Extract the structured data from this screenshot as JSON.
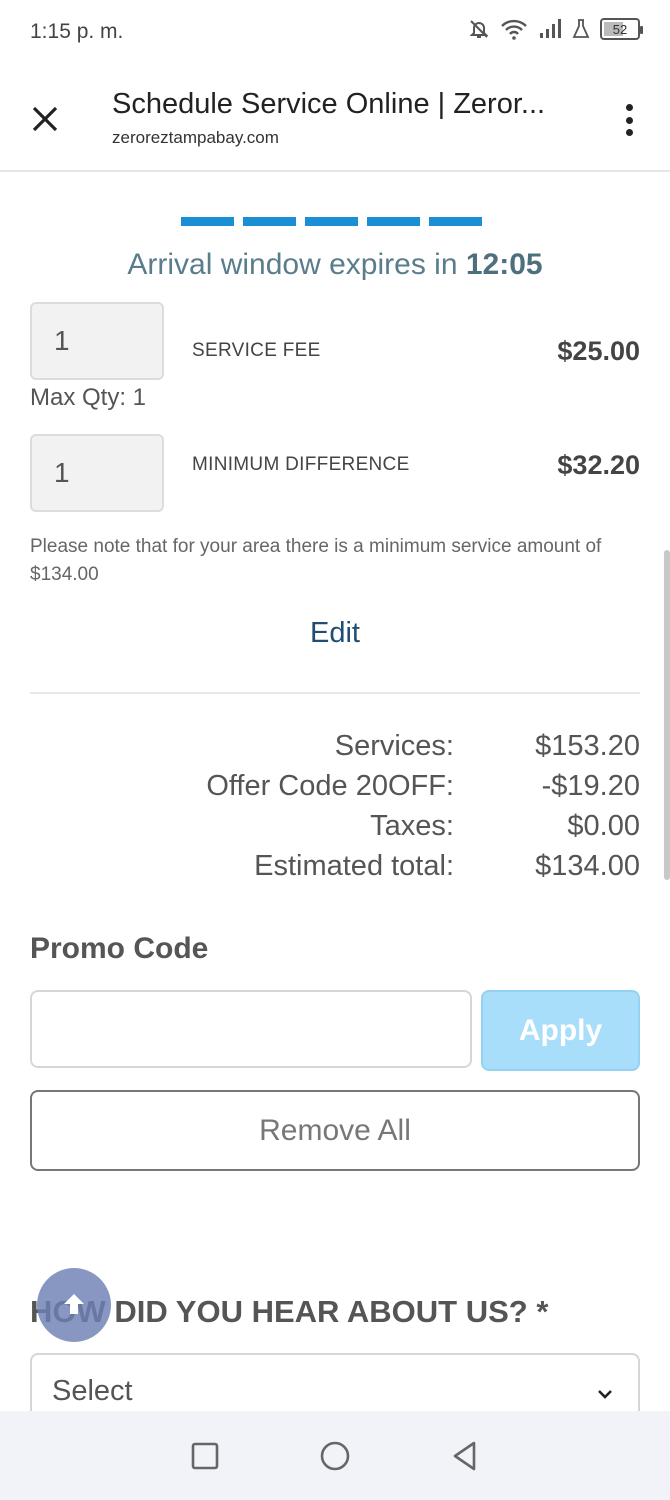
{
  "status_bar": {
    "time": "1:15 p. m.",
    "battery": "52",
    "icons": [
      "bell-muted-icon",
      "wifi-icon",
      "signal-icon",
      "flask-icon",
      "battery-icon"
    ]
  },
  "browser": {
    "title": "Schedule Service Online | Zeror...",
    "url": "zeroreztampabay.com",
    "icons": [
      "close-icon",
      "more-vert-icon"
    ]
  },
  "timer": {
    "prefix": "Arrival window expires in",
    "value": "12:05"
  },
  "line_items": [
    {
      "qty": "1",
      "name": "SERVICE FEE",
      "price": "$25.00",
      "max_qty": "Max Qty: 1"
    },
    {
      "qty": "1",
      "name": "MINIMUM DIFFERENCE",
      "price": "$32.20"
    }
  ],
  "note": "Please note that for your area there is a minimum service amount of $134.00",
  "edit_label": "Edit",
  "totals": [
    {
      "label": "Services:",
      "value": "$153.20"
    },
    {
      "label": "Offer Code 20OFF:",
      "value": "-$19.20"
    },
    {
      "label": "Taxes:",
      "value": "$0.00"
    },
    {
      "label": "Estimated total:",
      "value": "$134.00"
    }
  ],
  "promo": {
    "title": "Promo Code",
    "input_value": "",
    "apply_label": "Apply",
    "remove_label": "Remove All"
  },
  "referral": {
    "title": "HOW DID YOU HEAR ABOUT US? *",
    "selected": "Select"
  },
  "colors": {
    "progress": "#1a8fd6",
    "timer_text": "#5a7d8c",
    "apply_button": "#a8defa",
    "edit_link": "#1f4d73"
  }
}
